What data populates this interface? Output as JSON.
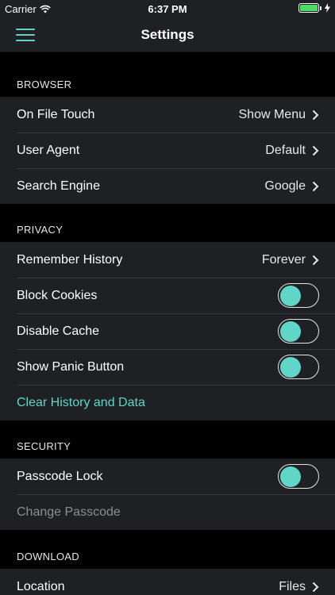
{
  "status": {
    "carrier": "Carrier",
    "time": "6:37 PM"
  },
  "nav": {
    "title": "Settings"
  },
  "browser": {
    "header": "BROWSER",
    "on_file_touch": {
      "label": "On File Touch",
      "value": "Show Menu"
    },
    "user_agent": {
      "label": "User Agent",
      "value": "Default"
    },
    "search_engine": {
      "label": "Search Engine",
      "value": "Google"
    }
  },
  "privacy": {
    "header": "PRIVACY",
    "remember_history": {
      "label": "Remember History",
      "value": "Forever"
    },
    "block_cookies": {
      "label": "Block Cookies"
    },
    "disable_cache": {
      "label": "Disable Cache"
    },
    "show_panic_button": {
      "label": "Show Panic Button"
    },
    "clear_history": {
      "label": "Clear History and Data"
    }
  },
  "security": {
    "header": "SECURITY",
    "passcode_lock": {
      "label": "Passcode Lock"
    },
    "change_passcode": {
      "label": "Change Passcode"
    }
  },
  "download": {
    "header": "DOWNLOAD",
    "location": {
      "label": "Location",
      "value": "Files"
    }
  },
  "colors": {
    "accent": "#5fd6c8",
    "row_bg": "#1e2024",
    "page_bg": "#000000",
    "battery": "#4cd964"
  }
}
